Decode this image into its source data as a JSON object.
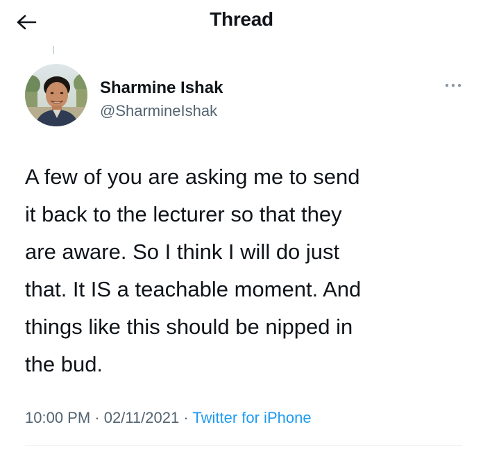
{
  "header": {
    "back_icon": "arrow-left-icon",
    "title": "Thread"
  },
  "author": {
    "name": "Sharmine Ishak",
    "handle": "@SharmineIshak",
    "avatar_icon": "avatar"
  },
  "more_icon": "more-horizontal-icon",
  "tweet": {
    "text": "A few of you are asking me to send\nit back to the lecturer so that they\nare aware. So I think I will do just\nthat. It IS a teachable moment. And\nthings like this should be nipped in\nthe bud."
  },
  "meta": {
    "time": "10:00 PM",
    "sep1": " · ",
    "date": "02/11/2021",
    "sep2": " · ",
    "source": "Twitter for iPhone"
  },
  "colors": {
    "text_primary": "#0f1419",
    "text_secondary": "#536471",
    "link": "#1d9bf0"
  }
}
